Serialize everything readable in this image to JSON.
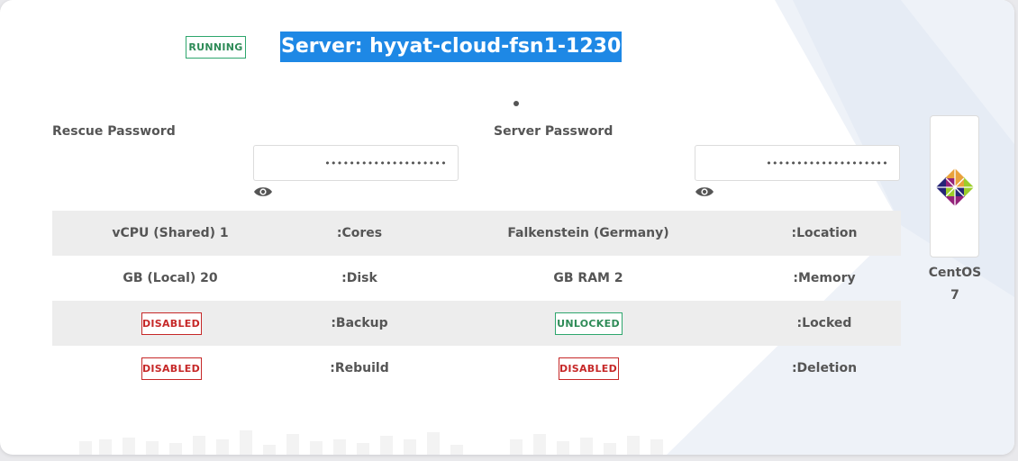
{
  "status_badge": "RUNNING",
  "title": "Server: hyyat-cloud-fsn1-1230",
  "rescue": {
    "label": "Rescue Password",
    "value": "••••••••••••••••••••"
  },
  "server_pw": {
    "label": "Server Password",
    "value": "••••••••••••••••••••"
  },
  "specs": [
    {
      "left": "vCPU (Shared) 1",
      "left_label": ":Cores",
      "right": "Falkenstein (Germany)",
      "right_label": ":Location"
    },
    {
      "left": "GB (Local) 20",
      "left_label": ":Disk",
      "right": "GB RAM 2",
      "right_label": ":Memory"
    },
    {
      "left": "DISABLED",
      "left_label": ":Backup",
      "right": "UNLOCKED",
      "right_label": ":Locked"
    },
    {
      "left": "DISABLED",
      "left_label": ":Rebuild",
      "right": "DISABLED",
      "right_label": ":Deletion"
    }
  ],
  "os": {
    "name": "CentOS",
    "version": "7"
  },
  "colors": {
    "accent": "#1e88e5",
    "success": "#2ea66d",
    "danger": "#c62828",
    "text": "#555555"
  },
  "icons": {
    "reveal": "eye-icon",
    "os_logo": "centos-logo"
  }
}
